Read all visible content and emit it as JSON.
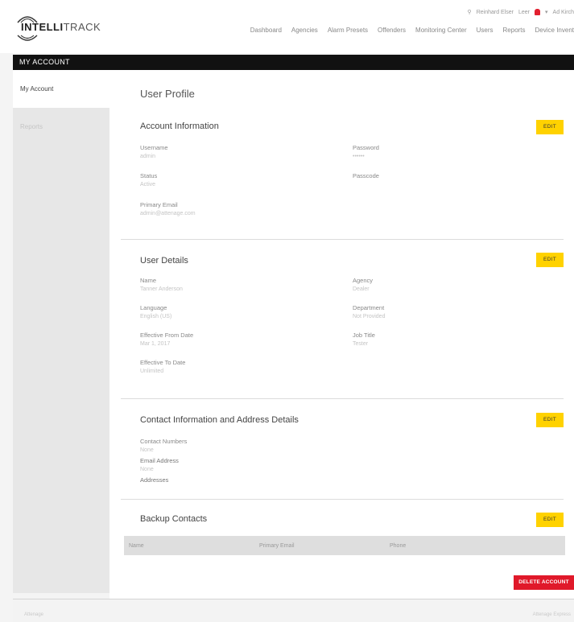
{
  "brand": {
    "logo_text_bold": "INTELLI",
    "logo_text_rest": "TRACK"
  },
  "top_util": {
    "search_label": "Reinhard Elser",
    "user_label": "Leer",
    "user_name": "Ad Kirch"
  },
  "nav": [
    "Dashboard",
    "Agencies",
    "Alarm Presets",
    "Offenders",
    "Monitoring Center",
    "Users",
    "Reports",
    "Device Invent"
  ],
  "banner": {
    "title": "MY ACCOUNT"
  },
  "sidebar": {
    "items": [
      {
        "label": "My Account"
      },
      {
        "label": "Reports"
      }
    ]
  },
  "page": {
    "title": "User Profile"
  },
  "edit_label": "EDIT",
  "account": {
    "title": "Account Information",
    "username_label": "Username",
    "username_value": "admin",
    "password_label": "Password",
    "password_value": "••••••",
    "status_label": "Status",
    "status_value": "Active",
    "passcode_label": "Passcode",
    "email_label": "Primary Email",
    "email_value": "admin@attenage.com"
  },
  "details": {
    "title": "User Details",
    "name_label": "Name",
    "name_value": "Tanner Anderson",
    "agency_label": "Agency",
    "agency_value": "Dealer",
    "language_label": "Language",
    "language_value": "English (US)",
    "department_label": "Department",
    "department_value": "Not Provided",
    "eff_from_label": "Effective From Date",
    "eff_from_value": "Mar 1, 2017",
    "jobtitle_label": "Job Title",
    "jobtitle_value": "Tester",
    "eff_to_label": "Effective To Date",
    "eff_to_value": "Unlimited"
  },
  "contact": {
    "title": "Contact Information and Address Details",
    "numbers_label": "Contact Numbers",
    "numbers_value": "None",
    "email_label": "Email Address",
    "email_value": "None",
    "addresses_label": "Addresses"
  },
  "backup": {
    "title": "Backup Contacts",
    "columns": [
      "Name",
      "Primary Email",
      "Phone"
    ]
  },
  "delete_label": "DELETE ACCOUNT",
  "footer": {
    "left": "Attenage",
    "right": "Attenage Express"
  },
  "colors": {
    "accent_yellow": "#ffd200",
    "danger_red": "#e0192a",
    "banner_black": "#111111"
  }
}
